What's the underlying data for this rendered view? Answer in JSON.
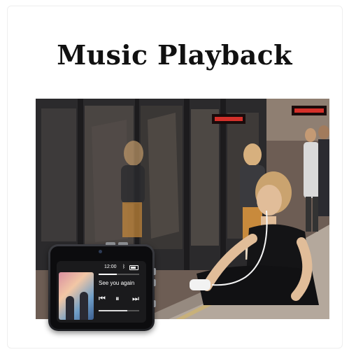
{
  "page": {
    "title": "Music Playback"
  },
  "scene": {
    "icon": "train-platform-photo"
  },
  "device": {
    "status_time": "12:00",
    "bluetooth_icon": "bluetooth-icon",
    "battery_icon": "battery-icon",
    "song_title": "See you again",
    "playback_progress": 0.45,
    "volume_level": 0.7,
    "controls": {
      "previous_glyph": "⏮",
      "pause_glyph": "⏸",
      "next_glyph": "⏭"
    }
  }
}
